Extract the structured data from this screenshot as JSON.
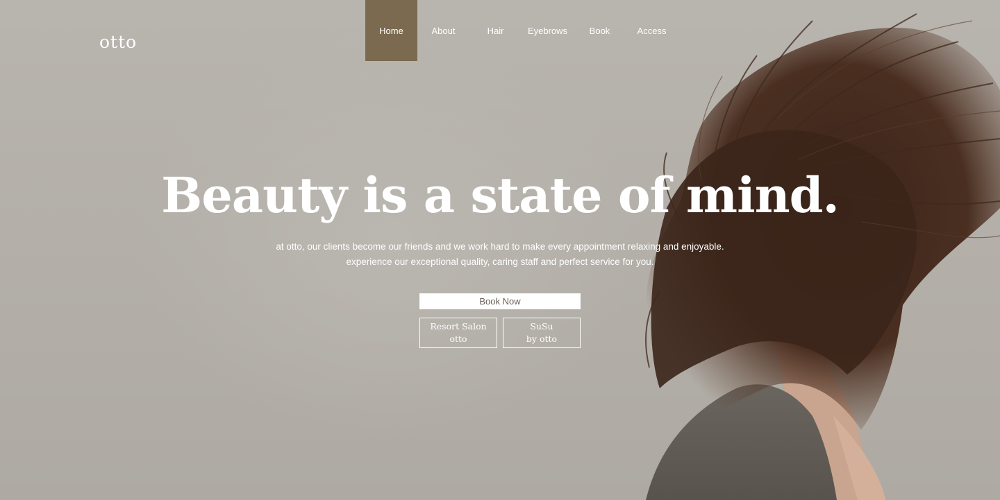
{
  "brand": {
    "logo_text": "otto"
  },
  "nav": {
    "items": [
      {
        "label": "Home",
        "active": true
      },
      {
        "label": "About",
        "active": false
      },
      {
        "label": "Hair",
        "active": false
      },
      {
        "label": "Eyebrows",
        "active": false
      },
      {
        "label": "Book",
        "active": false
      },
      {
        "label": "Access",
        "active": false
      }
    ]
  },
  "hero": {
    "headline": "Beauty is a state of mind.",
    "subtext_line1": "at otto, our clients become our friends and we work hard to make every appointment relaxing and enjoyable.",
    "subtext_line2": "experience our exceptional quality, caring staff and perfect service for you.",
    "book_now_label": "Book Now",
    "resort_salon": {
      "line1": "Resort Salon",
      "line2": "otto"
    },
    "susu": {
      "line1": "SuSu",
      "line2": "by otto"
    }
  },
  "colors": {
    "nav_active": "#7b6a50",
    "background": "#b4b0aa",
    "text": "#ffffff"
  }
}
